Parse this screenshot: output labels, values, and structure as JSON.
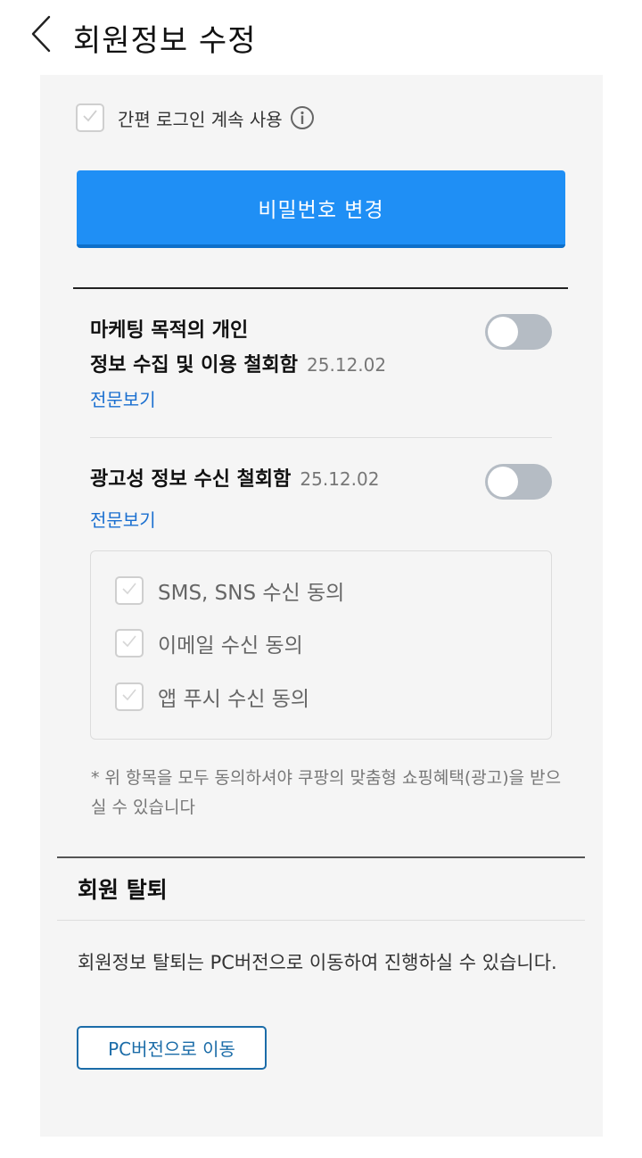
{
  "header": {
    "title": "회원정보 수정"
  },
  "easy_login": {
    "label": "간편 로그인 계속 사용",
    "checked": true
  },
  "password_button": {
    "label": "비밀번호 변경"
  },
  "consents": [
    {
      "title_line1": "마케팅 목적의 개인",
      "title_line2": "정보 수집 및 이용 철회함",
      "date": "25.12.02",
      "link": "전문보기",
      "enabled": false
    },
    {
      "title": "광고성 정보 수신 철회함",
      "date": "25.12.02",
      "link": "전문보기",
      "enabled": false
    }
  ],
  "channels": [
    {
      "label": "SMS, SNS 수신 동의",
      "checked": false
    },
    {
      "label": "이메일 수신 동의",
      "checked": false
    },
    {
      "label": "앱 푸시 수신 동의",
      "checked": false
    }
  ],
  "notice": "* 위 항목을 모두 동의하셔야 쿠팡의 맞춤형 쇼핑혜택(광고)을 받으실 수 있습니다",
  "withdraw": {
    "title": "회원 탈퇴",
    "description": "회원정보 탈퇴는 PC버전으로 이동하여 진행하실 수 있습니다.",
    "button_label": "PC버전으로 이동"
  },
  "colors": {
    "accent": "#1f8ff5",
    "link": "#1a6fd0",
    "toggle_off": "#b5bcc4"
  }
}
